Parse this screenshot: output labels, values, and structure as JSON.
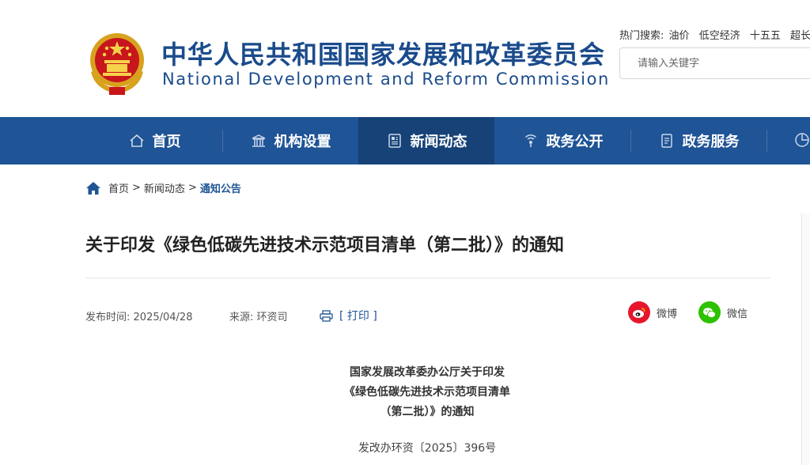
{
  "site": {
    "title_cn": "中华人民共和国国家发展和改革委员会",
    "title_en": "National Development and Reform Commission"
  },
  "hot_search": {
    "label": "热门搜索:",
    "terms": [
      "油价",
      "低空经济",
      "十五五",
      "超长"
    ]
  },
  "search": {
    "placeholder": "请输入关键字"
  },
  "nav": {
    "items": [
      {
        "label": "首页",
        "icon": "home-icon",
        "active": false
      },
      {
        "label": "机构设置",
        "icon": "building-icon",
        "active": false
      },
      {
        "label": "新闻动态",
        "icon": "news-icon",
        "active": true
      },
      {
        "label": "政务公开",
        "icon": "broadcast-icon",
        "active": false
      },
      {
        "label": "政务服务",
        "icon": "document-icon",
        "active": false
      }
    ]
  },
  "breadcrumb": {
    "items": [
      "首页",
      "新闻动态",
      "通知公告"
    ],
    "separator": ">"
  },
  "article": {
    "title": "关于印发《绿色低碳先进技术示范项目清单（第二批）》的通知",
    "publish_label": "发布时间:",
    "publish_date": "2025/04/28",
    "source_label": "来源:",
    "source": "环资司",
    "print_label": "[ 打印 ]",
    "share": {
      "weibo": "微博",
      "wechat": "微信"
    },
    "heading_lines": [
      "国家发展改革委办公厅关于印发",
      "《绿色低碳先进技术示范项目清单",
      "（第二批）》的通知"
    ],
    "doc_number": "发改办环资〔2025〕396号"
  },
  "colors": {
    "brand_blue": "#1f5496",
    "nav_active": "#164277",
    "weibo_red": "#e6162d",
    "wechat_green": "#2dc100"
  }
}
